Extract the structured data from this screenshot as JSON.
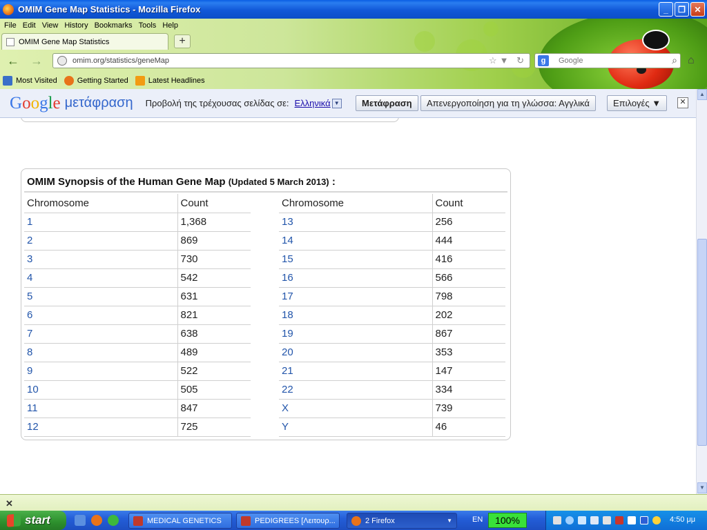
{
  "window": {
    "title": "OMIM Gene Map Statistics - Mozilla Firefox",
    "buttons": {
      "minimize": "_",
      "maximize": "❐",
      "close": "✕"
    }
  },
  "menu": [
    "File",
    "Edit",
    "View",
    "History",
    "Bookmarks",
    "Tools",
    "Help"
  ],
  "tab": {
    "label": "OMIM Gene Map Statistics",
    "new_tab": "+"
  },
  "nav": {
    "back": "←",
    "forward": "→",
    "url": "omim.org/statistics/geneMap",
    "url_icons": "☆▼ ↻",
    "search_placeholder": "Google",
    "search_engine_letter": "g",
    "search_icon": "⌕",
    "home": "⌂"
  },
  "bookmarks": [
    {
      "label": "Most Visited",
      "color": "#3a6fc8"
    },
    {
      "label": "Getting Started",
      "color": "#e8731a"
    },
    {
      "label": "Latest Headlines",
      "color": "#f29b12"
    }
  ],
  "translate_bar": {
    "logo_word": "μετάφραση",
    "prompt": "Προβολή της τρέχουσας σελίδας σε:",
    "language": "Ελληνικά",
    "drop_glyph": "▼",
    "translate_button": "Μετάφραση",
    "disable_button": "Απενεργοποίηση για τη γλώσσα: Αγγλικά",
    "options_button": "Επιλογές ▼",
    "close": "✕"
  },
  "synopsis": {
    "title": "OMIM Synopsis of the Human Gene Map",
    "updated": "(Updated 5 March 2013)",
    "colon": ":",
    "headers": {
      "chromosome": "Chromosome",
      "count": "Count"
    },
    "left_rows": [
      {
        "chromosome": "1",
        "count": "1,368"
      },
      {
        "chromosome": "2",
        "count": "869"
      },
      {
        "chromosome": "3",
        "count": "730"
      },
      {
        "chromosome": "4",
        "count": "542"
      },
      {
        "chromosome": "5",
        "count": "631"
      },
      {
        "chromosome": "6",
        "count": "821"
      },
      {
        "chromosome": "7",
        "count": "638"
      },
      {
        "chromosome": "8",
        "count": "489"
      },
      {
        "chromosome": "9",
        "count": "522"
      },
      {
        "chromosome": "10",
        "count": "505"
      },
      {
        "chromosome": "11",
        "count": "847"
      },
      {
        "chromosome": "12",
        "count": "725"
      }
    ],
    "right_rows": [
      {
        "chromosome": "13",
        "count": "256"
      },
      {
        "chromosome": "14",
        "count": "444"
      },
      {
        "chromosome": "15",
        "count": "416"
      },
      {
        "chromosome": "16",
        "count": "566"
      },
      {
        "chromosome": "17",
        "count": "798"
      },
      {
        "chromosome": "18",
        "count": "202"
      },
      {
        "chromosome": "19",
        "count": "867"
      },
      {
        "chromosome": "20",
        "count": "353"
      },
      {
        "chromosome": "21",
        "count": "147"
      },
      {
        "chromosome": "22",
        "count": "334"
      },
      {
        "chromosome": "X",
        "count": "739"
      },
      {
        "chromosome": "Y",
        "count": "46"
      }
    ]
  },
  "findbar": {
    "close": "✕"
  },
  "taskbar": {
    "start": "start",
    "items": [
      {
        "label": "MEDICAL GENETICS",
        "active": false
      },
      {
        "label": "PEDIGREES [Λειτουρ...",
        "active": false
      },
      {
        "label": "2 Firefox",
        "active": true
      }
    ],
    "language": "EN",
    "zoom": "100%",
    "clock": "4:50 μμ"
  },
  "colors": {
    "link": "#2255aa",
    "titlebar": "#0a5ee4",
    "taskbar": "#245ed8",
    "start": "#2d8f2d"
  }
}
